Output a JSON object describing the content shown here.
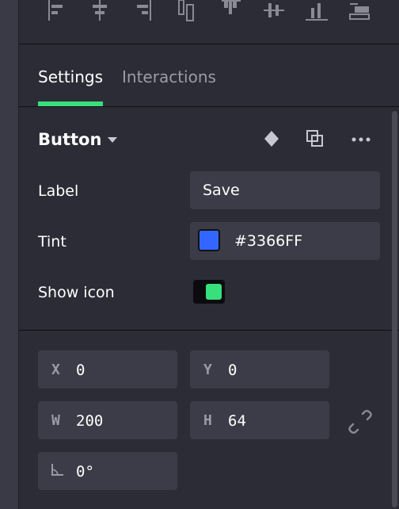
{
  "align_toolbar": {
    "icons": [
      "align-left-icon",
      "align-center-horizontal-icon",
      "align-right-icon",
      "align-top-icon",
      "align-middle-vertical-icon",
      "align-center-vertical-icon",
      "align-bottom-icon",
      "distribute-icon"
    ]
  },
  "tabs": {
    "settings": "Settings",
    "interactions": "Interactions",
    "active": "settings",
    "accent": "#37e07a"
  },
  "component": {
    "title": "Button",
    "label_caption": "Label",
    "label_value": "Save",
    "tint_caption": "Tint",
    "tint_value": "#3366FF",
    "tint_color": "#3366FF",
    "show_icon_caption": "Show icon",
    "show_icon_on": true
  },
  "geometry": {
    "x_label": "X",
    "x_value": "0",
    "y_label": "Y",
    "y_value": "0",
    "w_label": "W",
    "w_value": "200",
    "h_label": "H",
    "h_value": "64",
    "rotation_value": "0°"
  }
}
